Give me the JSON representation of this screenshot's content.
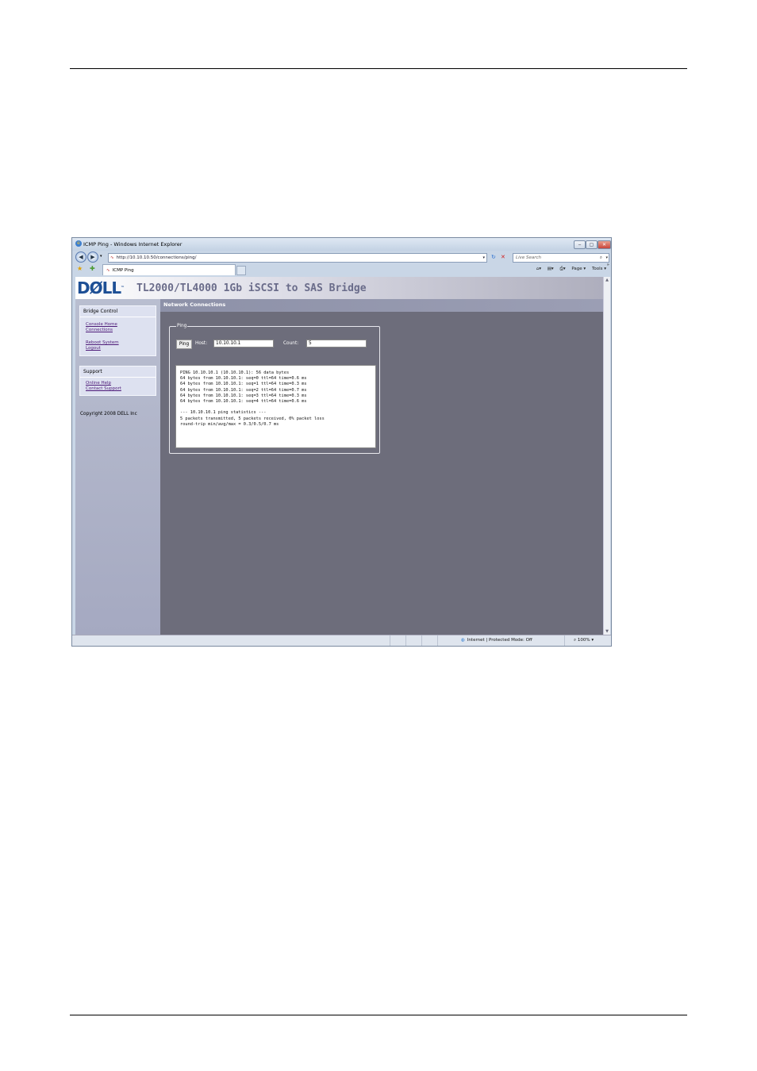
{
  "window": {
    "title": "ICMP Ping - Windows Internet Explorer",
    "controls": {
      "minimize": "‒",
      "maximize": "▢",
      "close": "✕"
    }
  },
  "browser": {
    "address": "http://10.10.10.50/connections/ping/",
    "search_placeholder": "Live Search",
    "tab_title": "ICMP Ping",
    "toolbar": [
      "Page ▾",
      "Tools ▾"
    ],
    "chevron": "»",
    "status_zone": "Internet | Protected Mode: Off",
    "zoom": "100%"
  },
  "page": {
    "logo": "DØLL",
    "logo_tm": "™",
    "header_title": "TL2000/TL4000 1Gb iSCSI to SAS Bridge",
    "subheader": "Network Connections",
    "sidebar": {
      "bridge_control": {
        "title": "Bridge Control",
        "links": [
          "Console Home",
          "Connections",
          "Reboot System",
          "Logout"
        ]
      },
      "support": {
        "title": "Support",
        "links": [
          "Online Help",
          "Contact Support"
        ]
      },
      "copyright": "Copyright 2008 DELL Inc"
    },
    "ping": {
      "legend": "Ping",
      "button": "Ping",
      "host_label": "Host:",
      "host_value": "10.10.10.1",
      "count_label": "Count:",
      "count_value": "5",
      "output": "PING 10.10.10.1 (10.10.10.1): 56 data bytes\n64 bytes from 10.10.10.1: seq=0 ttl=64 time=0.6 ms\n64 bytes from 10.10.10.1: seq=1 ttl=64 time=0.3 ms\n64 bytes from 10.10.10.1: seq=2 ttl=64 time=0.7 ms\n64 bytes from 10.10.10.1: seq=3 ttl=64 time=0.3 ms\n64 bytes from 10.10.10.1: seq=4 ttl=64 time=0.6 ms\n\n--- 10.10.10.1 ping statistics ---\n5 packets transmitted, 5 packets received, 0% packet loss\nround-trip min/avg/max = 0.3/0.5/0.7 ms"
    }
  },
  "colors": {
    "page_bg": "#6d6d7b",
    "sidebar_bg": "#a5a9c1",
    "logo": "#1d4f95",
    "link": "#4d1a78"
  }
}
